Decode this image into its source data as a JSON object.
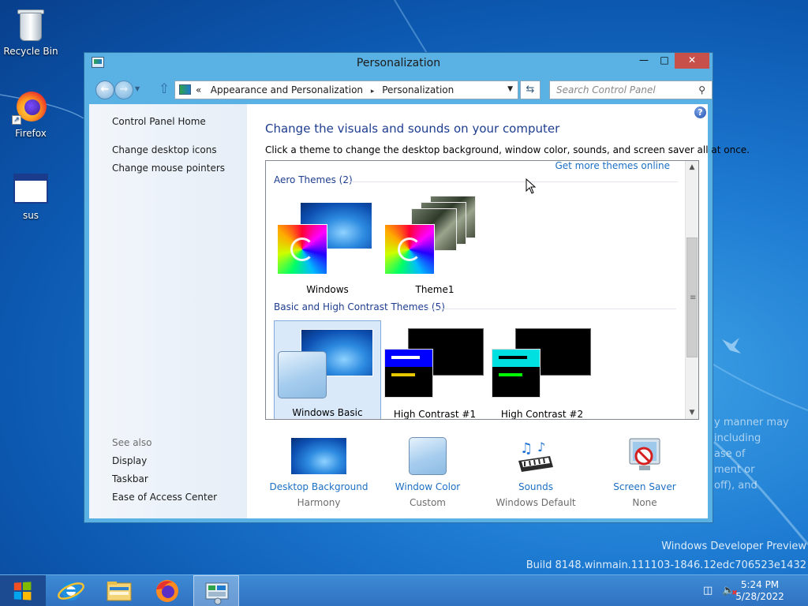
{
  "desktop": {
    "icons": [
      {
        "label": "Recycle Bin",
        "icon": "recycle-bin-icon"
      },
      {
        "label": "Firefox",
        "icon": "firefox-icon"
      },
      {
        "label": "sus",
        "icon": "application-window-icon"
      }
    ],
    "watermark_line1": "Windows Developer Preview",
    "watermark_line2": "Build 8148.winmain.111103-1846.12edc706523e1432",
    "ghost_text": [
      "y manner may",
      "including",
      "ase of",
      "ment or",
      "off), and"
    ]
  },
  "window": {
    "title": "Personalization",
    "buttons": {
      "minimize": "—",
      "maximize": "□",
      "close": "✕"
    },
    "address": {
      "prefix": "«",
      "crumbs": [
        "Appearance and Personalization",
        "Personalization"
      ],
      "separator": "▸"
    },
    "search": {
      "placeholder": "Search Control Panel"
    },
    "left_pane": {
      "links": [
        "Control Panel Home",
        "Change desktop icons",
        "Change mouse pointers"
      ],
      "see_also_label": "See also",
      "see_also": [
        "Display",
        "Taskbar",
        "Ease of Access Center"
      ]
    },
    "main": {
      "title": "Change the visuals and sounds on your computer",
      "description": "Click a theme to change the desktop background, window color, sounds, and screen saver all at once.",
      "get_more": "Get more themes online",
      "aero_header": "Aero Themes (2)",
      "aero_themes": [
        "Windows",
        "Theme1"
      ],
      "basic_header": "Basic and High Contrast Themes (5)",
      "basic_themes": [
        "Windows Basic",
        "High Contrast #1",
        "High Contrast #2"
      ],
      "selected_theme": "Windows Basic"
    },
    "bottom": [
      {
        "label": "Desktop Background",
        "value": "Harmony",
        "icon": "desktop-background-icon"
      },
      {
        "label": "Window Color",
        "value": "Custom",
        "icon": "window-color-icon"
      },
      {
        "label": "Sounds",
        "value": "Windows Default",
        "icon": "sounds-icon"
      },
      {
        "label": "Screen Saver",
        "value": "None",
        "icon": "screen-saver-icon"
      }
    ]
  },
  "taskbar": {
    "pinned": [
      "internet-explorer-icon",
      "file-explorer-icon",
      "firefox-icon",
      "control-panel-icon"
    ],
    "active": "control-panel-icon",
    "time": "5:24 PM",
    "date": "5/28/2022"
  },
  "colors": {
    "accent": "#5ab1e3",
    "link": "#1c6fc4",
    "heading": "#1e3d8f"
  }
}
